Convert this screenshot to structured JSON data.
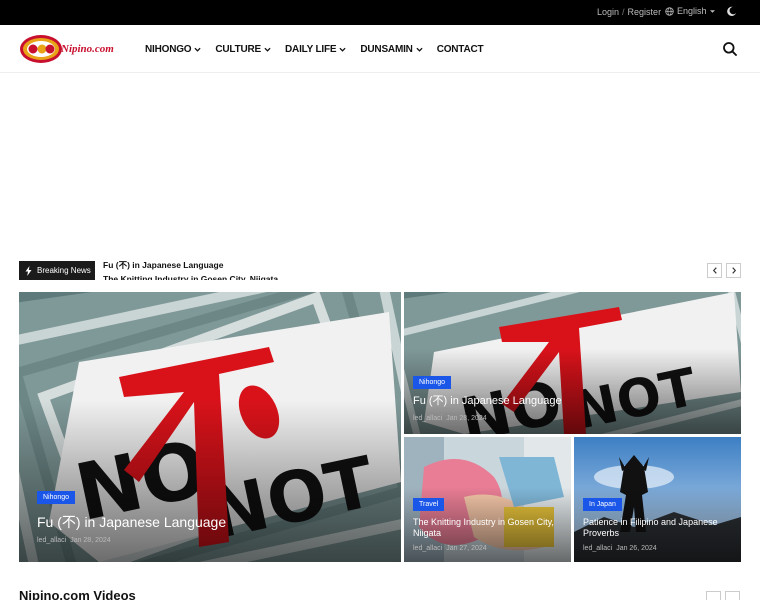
{
  "topbar": {
    "login": "Login",
    "separator": "/",
    "register": "Register",
    "language": "English"
  },
  "header": {
    "logo_text": "Nipino.com",
    "nav": [
      {
        "label": "NIHONGO",
        "dropdown": true
      },
      {
        "label": "CULTURE",
        "dropdown": true
      },
      {
        "label": "DAILY LIFE",
        "dropdown": true
      },
      {
        "label": "DUNSAMIN",
        "dropdown": true
      },
      {
        "label": "CONTACT",
        "dropdown": false
      }
    ]
  },
  "breaking": {
    "label": "Breaking News",
    "items": [
      "Fu (不) in Japanese Language",
      "The Knitting Industry in Gosen City, Niigata"
    ]
  },
  "cards": {
    "big": {
      "category": "Nihongo",
      "title": "Fu (不) in Japanese Language",
      "author": "led_allaci",
      "date": "Jan 28, 2024"
    },
    "top_right": {
      "category": "Nihongo",
      "title": "Fu (不) in Japanese Language",
      "author": "led_allaci",
      "date": "Jan 28, 2024"
    },
    "bottom_left": {
      "category": "Travel",
      "title": "The Knitting Industry in Gosen City, Niigata",
      "author": "led_allaci",
      "date": "Jan 27, 2024"
    },
    "bottom_right": {
      "category": "In Japan",
      "title": "Patience in Filipino and Japanese Proverbs",
      "author": "led_allaci",
      "date": "Jan 26, 2024"
    }
  },
  "videos": {
    "title": "Nipino.com Videos"
  },
  "colors": {
    "accent": "#1a56e8",
    "topbar": "#000000",
    "logo_red": "#c8102e",
    "logo_gold": "#e8a317"
  }
}
